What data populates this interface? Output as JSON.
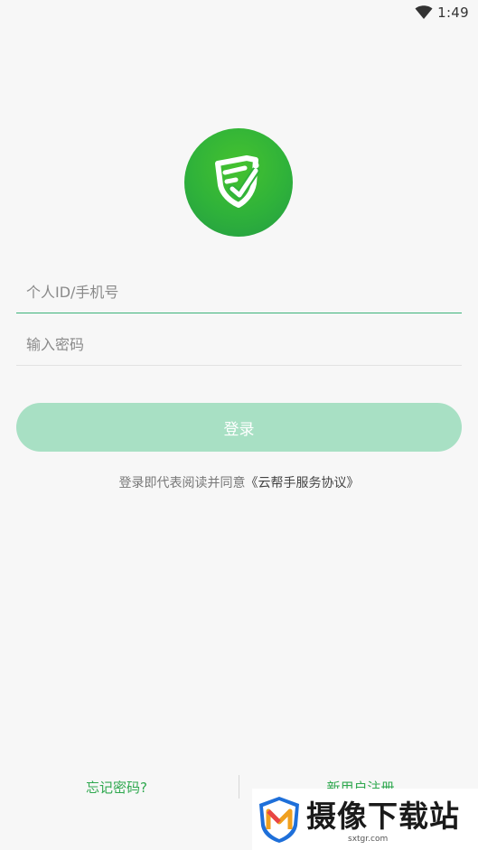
{
  "status_bar": {
    "time": "1:49",
    "icons": [
      "wifi-icon"
    ]
  },
  "logo": {
    "icon": "shield-check-logo",
    "color": "#2fb23a"
  },
  "login_form": {
    "id_placeholder": "个人ID/手机号",
    "id_value": "",
    "password_placeholder": "输入密码",
    "password_value": "",
    "login_label": "登录"
  },
  "agreement": {
    "prefix": "登录即代表阅读并同意",
    "link": "《云帮手服务协议》"
  },
  "bottom_links": {
    "forgot": "忘记密码?",
    "register": "新用户注册"
  },
  "watermark": {
    "title": "摄像下载站",
    "subtitle": "sxtgr.com"
  },
  "colors": {
    "accent": "#2fa84f",
    "button_disabled": "#a8e0c4",
    "background": "#f7f7f7"
  }
}
